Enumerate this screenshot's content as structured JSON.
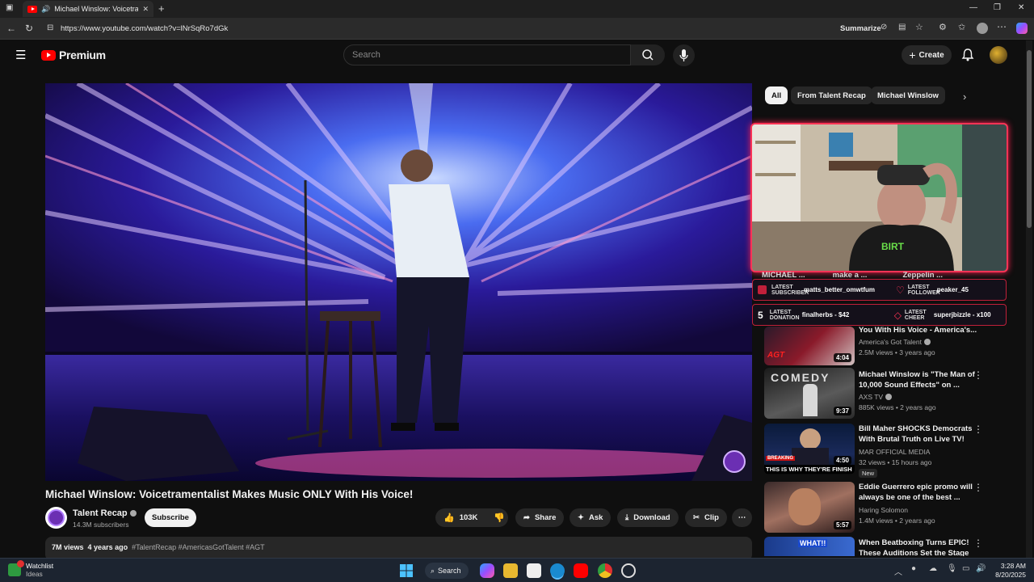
{
  "browser": {
    "tab_title": "Michael Winslow: Voicetram",
    "url": "https://www.youtube.com/watch?v=lNrSqRo7dGk",
    "summarize_label": "Summarize"
  },
  "youtube": {
    "logo_text": "Premium",
    "search_placeholder": "Search",
    "create_label": "Create"
  },
  "video": {
    "title": "Michael Winslow: Voicetramentalist Makes Music ONLY With His Voice!",
    "channel": "Talent Recap",
    "subscribers": "14.3M subscribers",
    "subscribe_label": "Subscribe",
    "likes": "103K",
    "share_label": "Share",
    "ask_label": "Ask",
    "download_label": "Download",
    "clip_label": "Clip",
    "views": "7M views",
    "age": "4 years ago",
    "tags": "#TalentRecap #AmericasGotTalent #AGT"
  },
  "chips": [
    "All",
    "From Talent Recap",
    "Michael Winslow"
  ],
  "overlay": {
    "names": [
      "MICHAEL ...",
      "make a ...",
      "Zeppelin ..."
    ],
    "subscriber_label": "LATEST SUBSCRIBER",
    "subscriber_value": "matts_better_omwtfum",
    "follower_label": "LATEST FOLLOWER",
    "follower_value": "peaker_45",
    "donation_label": "LATEST DONATION",
    "donation_value": "finalherbs - $42",
    "cheer_label": "LATEST CHEER",
    "cheer_value": "superjbizzle - x100",
    "bar_number": "5"
  },
  "recommendations": [
    {
      "title": "You With His Voice - America's...",
      "channel": "America's Got Talent",
      "meta": "2.5M views • 3 years ago",
      "duration": "4:04"
    },
    {
      "title": "Michael Winslow is \"The Man of 10,000 Sound Effects\" on ...",
      "channel": "AXS TV",
      "meta": "885K views • 2 years ago",
      "duration": "9:37"
    },
    {
      "title": "Bill Maher SHOCKS Democrats With Brutal Truth on Live TV!",
      "channel": "MAR OFFICIAL MEDIA",
      "meta": "32 views • 15 hours ago",
      "badge": "New",
      "duration": "4:50",
      "thumb_text": "THIS IS WHY THEY'RE FINISH",
      "thumb_label": "BREAKING"
    },
    {
      "title": "Eddie Guerrero epic promo will always be one of the best ...",
      "channel": "Haring Solomon",
      "meta": "1.4M views • 2 years ago",
      "duration": "5:57"
    },
    {
      "title": "When Beatboxing Turns EPIC! These Auditions Set the Stage",
      "thumb_text": "WHAT!!"
    }
  ],
  "taskbar": {
    "widget_title": "Watchlist",
    "widget_sub": "Ideas",
    "search_label": "Search",
    "time": "3:28 AM",
    "date": "8/20/2025"
  }
}
